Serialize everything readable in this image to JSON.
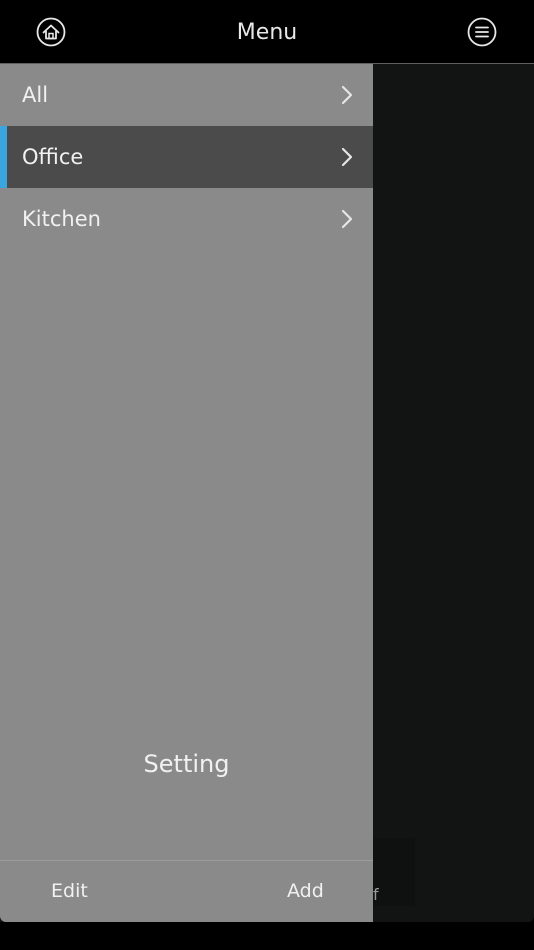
{
  "header": {
    "title": "Menu",
    "home_icon": "home-icon",
    "menu_icon": "hamburger-menu-icon"
  },
  "drawer": {
    "items": [
      {
        "label": "All",
        "selected": false
      },
      {
        "label": "Office",
        "selected": true
      },
      {
        "label": "Kitchen",
        "selected": false
      }
    ],
    "setting_label": "Setting",
    "edit_label": "Edit",
    "add_label": "Add"
  },
  "background": {
    "partial_text": "f"
  },
  "colors": {
    "accent": "#3aa6e0",
    "drawer_bg": "#8a8a8a",
    "selected_bg": "#4b4b4b",
    "topbar_bg": "#000000"
  }
}
